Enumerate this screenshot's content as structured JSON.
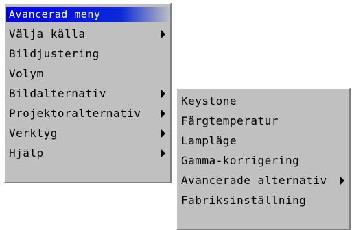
{
  "main_menu": {
    "title": "Avancerad meny",
    "items": [
      {
        "label": "Välja källa",
        "submenu": true
      },
      {
        "label": "Bildjustering",
        "submenu": false
      },
      {
        "label": "Volym",
        "submenu": false
      },
      {
        "label": "Bildalternativ",
        "submenu": true
      },
      {
        "label": "Projektoralternativ",
        "submenu": true
      },
      {
        "label": "Verktyg",
        "submenu": true
      },
      {
        "label": "Hjälp",
        "submenu": true
      }
    ]
  },
  "sub_menu": {
    "items": [
      {
        "label": "Keystone",
        "submenu": false
      },
      {
        "label": "Färgtemperatur",
        "submenu": false
      },
      {
        "label": "Lampläge",
        "submenu": false
      },
      {
        "label": "Gamma-korrigering",
        "submenu": false
      },
      {
        "label": "Avancerade alternativ",
        "submenu": true
      },
      {
        "label": "Fabriksinställning",
        "submenu": false
      }
    ]
  },
  "colors": {
    "menu_background": "#c0c0c0",
    "title_highlight": "#0000e8",
    "title_text": "#ffffff",
    "item_text": "#000000"
  },
  "icons": {
    "submenu_arrow": "triangle-right-icon"
  }
}
